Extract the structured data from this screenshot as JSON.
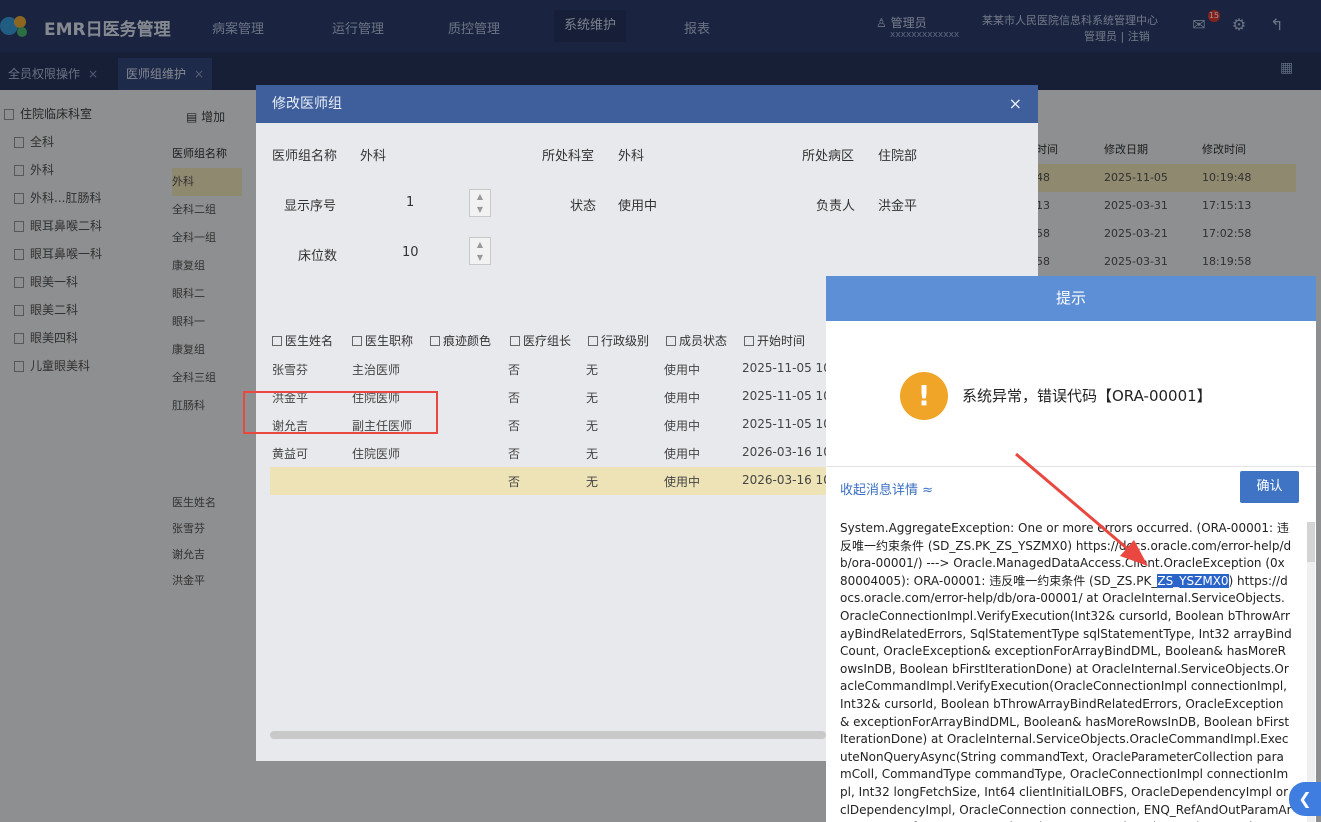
{
  "header": {
    "app_title": "EMR日医务管理",
    "nav": [
      "病案管理",
      "运行管理",
      "质控管理",
      "系统维护",
      "报表"
    ],
    "user_name": "管理员",
    "user_sub": "xxxxxxxxxxxxx",
    "hospital": "某某市人民医院信息科系统管理中心",
    "hospital_sub": "管理员 | 注销",
    "badge_count": "15"
  },
  "tabs": [
    {
      "label": "全员权限操作"
    },
    {
      "label": "医师组维护"
    }
  ],
  "tree": {
    "root": "住院临床科室",
    "items": [
      "全科",
      "外科",
      "外科...肛肠科",
      "眼耳鼻喉二科",
      "眼耳鼻喉一科",
      "眼美一科",
      "眼美二科",
      "眼美四科",
      "儿童眼美科"
    ]
  },
  "toolbar": {
    "add_label": "增加"
  },
  "group_list": {
    "header": "医师组名称",
    "rows": [
      "外科",
      "全科二组",
      "全科一组",
      "康复组",
      "眼科二",
      "眼科一",
      "康复组",
      "全科三组",
      "肛肠科"
    ]
  },
  "member_list": {
    "header": "医生姓名",
    "rows": [
      "张雪芬",
      "谢允吉",
      "洪金平"
    ]
  },
  "right_table": {
    "headers": [
      "时间",
      "修改日期",
      "修改时间"
    ],
    "rows": [
      [
        "48",
        "2025-11-05",
        "10:19:48"
      ],
      [
        "13",
        "2025-03-31",
        "17:15:13"
      ],
      [
        "58",
        "2025-03-21",
        "17:02:58"
      ],
      [
        "58",
        "2025-03-31",
        "18:19:58"
      ]
    ]
  },
  "edit_dialog": {
    "title": "修改医师组",
    "close_icon": "×",
    "fields": {
      "name_label": "医师组名称",
      "name_value": "外科",
      "dept_label": "所处科室",
      "dept_value": "外科",
      "ward_label": "所处病区",
      "ward_value": "住院部",
      "order_label": "显示序号",
      "order_value": "1",
      "status_label": "状态",
      "status_value": "使用中",
      "leader_label": "负责人",
      "leader_value": "洪金平",
      "beds_label": "床位数",
      "beds_value": "10"
    },
    "table": {
      "headers": [
        "医生姓名",
        "医生职称",
        "痕迹颜色",
        "医疗组长",
        "行政级别",
        "成员状态",
        "开始时间"
      ],
      "rows": [
        [
          "张雪芬",
          "主治医师",
          "",
          "否",
          "无",
          "使用中",
          "2025-11-05 10"
        ],
        [
          "洪金平",
          "住院医师",
          "",
          "否",
          "无",
          "使用中",
          "2025-11-05 10"
        ],
        [
          "谢允吉",
          "副主任医师",
          "",
          "否",
          "无",
          "使用中",
          "2025-11-05 10"
        ],
        [
          "黄益可",
          "住院医师",
          "",
          "否",
          "无",
          "使用中",
          "2026-03-16 10"
        ],
        [
          "",
          "",
          "",
          "否",
          "无",
          "使用中",
          "2026-03-16 10"
        ]
      ]
    }
  },
  "alert": {
    "title": "提示",
    "message": "系统异常，错误代码【ORA-00001】",
    "toggle_label": "收起消息详情 ≈",
    "ok_label": "确认",
    "detail_before": "System.AggregateException: One or more errors occurred. (ORA-00001: 违反唯一约束条件 (SD_ZS.PK_ZS_YSZMX0) https://docs.oracle.com/error-help/db/ora-00001/) ---> Oracle.ManagedDataAccess.Client.OracleException (0x80004005): ORA-00001: 违反唯一约束条件 (SD_ZS.PK_",
    "detail_selected": "ZS_YSZMX0",
    "detail_after": ") https://docs.oracle.com/error-help/db/ora-00001/ at OracleInternal.ServiceObjects.OracleConnectionImpl.VerifyExecution(Int32& cursorId, Boolean bThrowArrayBindRelatedErrors, SqlStatementType sqlStatementType, Int32 arrayBindCount, OracleException& exceptionForArrayBindDML, Boolean& hasMoreRowsInDB, Boolean bFirstIterationDone) at OracleInternal.ServiceObjects.OracleCommandImpl.VerifyExecution(OracleConnectionImpl connectionImpl, Int32& cursorId, Boolean bThrowArrayBindRelatedErrors, OracleException& exceptionForArrayBindDML, Boolean& hasMoreRowsInDB, Boolean bFirstIterationDone) at OracleInternal.ServiceObjects.OracleCommandImpl.ExecuteNonQueryAsync(String commandText, OracleParameterCollection paramColl, CommandType commandType, OracleConnectionImpl connectionImpl, Int32 longFetchSize, Int64 clientInitialLOBFS, OracleDependencyImpl orclDependencyImpl, OracleConnection connection, ENQ_RefAndOutParamArgCtx enq_refOutArgCtx, Boolean isFromEF, Boolean bAsync) at Oracle.ManagedDataAccess.Client.OracleCommand.ExecuteNonQueryInternalAsy"
  },
  "colors": {
    "header": "#2d3f70",
    "accent": "#3f74c4",
    "warning": "#f0a428",
    "annotation": "#e9473f"
  }
}
